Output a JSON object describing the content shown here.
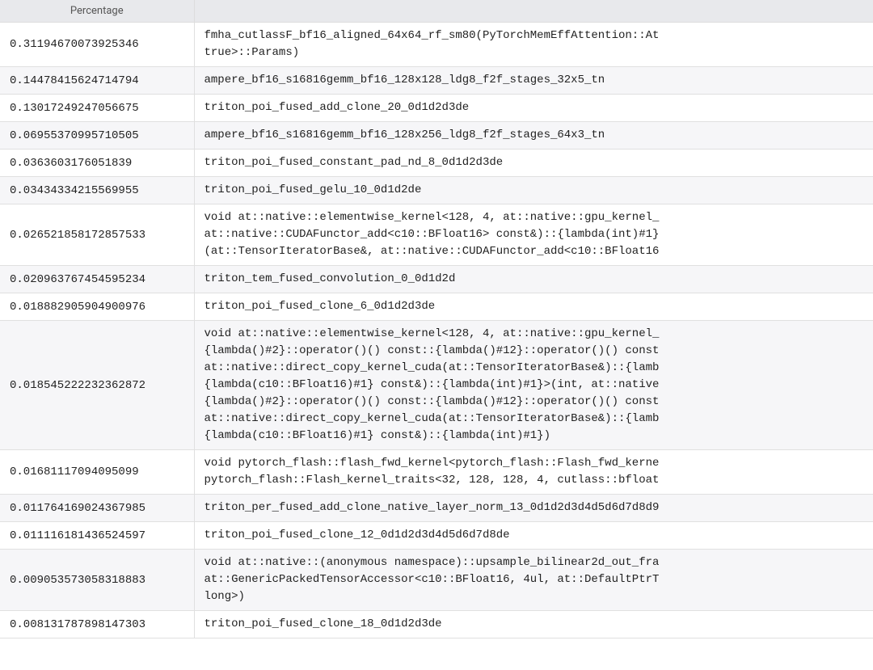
{
  "table": {
    "columns": {
      "percentage": "Percentage",
      "kernel": ""
    },
    "rows": [
      {
        "percentage": "0.31194670073925346",
        "kernel": "fmha_cutlassF_bf16_aligned_64x64_rf_sm80(PyTorchMemEffAttention::At\ntrue>::Params)"
      },
      {
        "percentage": "0.14478415624714794",
        "kernel": "ampere_bf16_s16816gemm_bf16_128x128_ldg8_f2f_stages_32x5_tn"
      },
      {
        "percentage": "0.13017249247056675",
        "kernel": "triton_poi_fused_add_clone_20_0d1d2d3de"
      },
      {
        "percentage": "0.06955370995710505",
        "kernel": "ampere_bf16_s16816gemm_bf16_128x256_ldg8_f2f_stages_64x3_tn"
      },
      {
        "percentage": "0.0363603176051839",
        "kernel": "triton_poi_fused_constant_pad_nd_8_0d1d2d3de"
      },
      {
        "percentage": "0.03434334215569955",
        "kernel": "triton_poi_fused_gelu_10_0d1d2de"
      },
      {
        "percentage": "0.026521858172857533",
        "kernel": "void at::native::elementwise_kernel<128, 4, at::native::gpu_kernel_\nat::native::CUDAFunctor_add<c10::BFloat16> const&)::{lambda(int)#1}\n(at::TensorIteratorBase&, at::native::CUDAFunctor_add<c10::BFloat16"
      },
      {
        "percentage": "0.020963767454595234",
        "kernel": "triton_tem_fused_convolution_0_0d1d2d"
      },
      {
        "percentage": "0.018882905904900976",
        "kernel": "triton_poi_fused_clone_6_0d1d2d3de"
      },
      {
        "percentage": "0.018545222232362872",
        "kernel": "void at::native::elementwise_kernel<128, 4, at::native::gpu_kernel_\n{lambda()#2}::operator()() const::{lambda()#12}::operator()() const\nat::native::direct_copy_kernel_cuda(at::TensorIteratorBase&)::{lamb\n{lambda(c10::BFloat16)#1} const&)::{lambda(int)#1}>(int, at::native\n{lambda()#2}::operator()() const::{lambda()#12}::operator()() const\nat::native::direct_copy_kernel_cuda(at::TensorIteratorBase&)::{lamb\n{lambda(c10::BFloat16)#1} const&)::{lambda(int)#1})"
      },
      {
        "percentage": "0.01681117094095099",
        "kernel": "void pytorch_flash::flash_fwd_kernel<pytorch_flash::Flash_fwd_kerne\npytorch_flash::Flash_kernel_traits<32, 128, 128, 4, cutlass::bfloat"
      },
      {
        "percentage": "0.011764169024367985",
        "kernel": "triton_per_fused_add_clone_native_layer_norm_13_0d1d2d3d4d5d6d7d8d9"
      },
      {
        "percentage": "0.011116181436524597",
        "kernel": "triton_poi_fused_clone_12_0d1d2d3d4d5d6d7d8de"
      },
      {
        "percentage": "0.009053573058318883",
        "kernel": "void at::native::(anonymous namespace)::upsample_bilinear2d_out_fra\nat::GenericPackedTensorAccessor<c10::BFloat16, 4ul, at::DefaultPtrT\nlong>)"
      },
      {
        "percentage": "0.008131787898147303",
        "kernel": "triton_poi_fused_clone_18_0d1d2d3de"
      }
    ]
  }
}
